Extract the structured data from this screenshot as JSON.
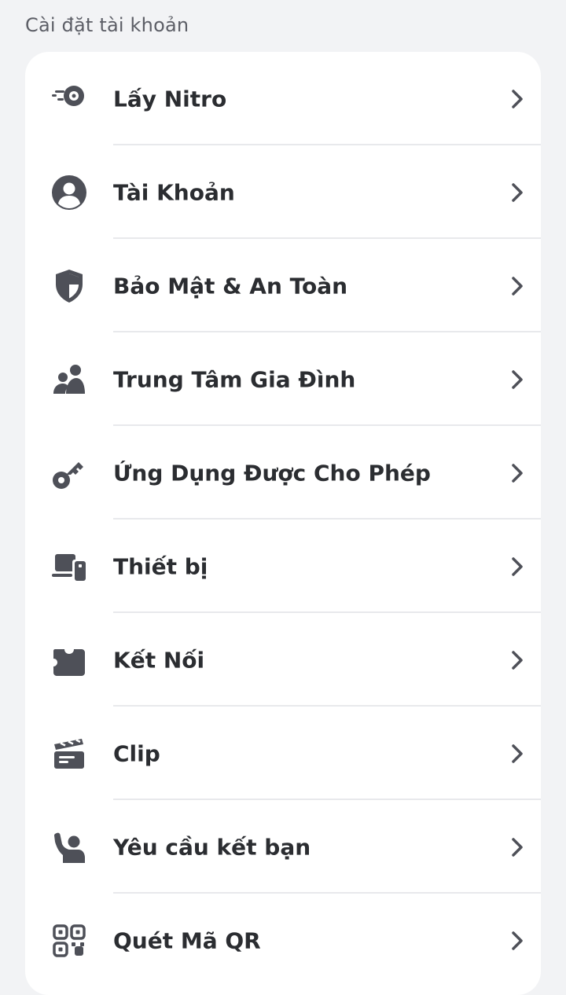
{
  "section_title": "Cài đặt tài khoản",
  "items": [
    {
      "label": "Lấy Nitro",
      "icon": "nitro-icon"
    },
    {
      "label": "Tài Khoản",
      "icon": "account-icon"
    },
    {
      "label": "Bảo Mật & An Toàn",
      "icon": "shield-icon"
    },
    {
      "label": "Trung Tâm Gia Đình",
      "icon": "family-icon"
    },
    {
      "label": "Ứng Dụng Được Cho Phép",
      "icon": "key-icon"
    },
    {
      "label": "Thiết bị",
      "icon": "devices-icon"
    },
    {
      "label": "Kết Nối",
      "icon": "puzzle-icon"
    },
    {
      "label": "Clip",
      "icon": "clapperboard-icon"
    },
    {
      "label": "Yêu cầu kết bạn",
      "icon": "friend-request-icon"
    },
    {
      "label": "Quét Mã QR",
      "icon": "qr-code-icon"
    }
  ],
  "colors": {
    "background": "#f2f3f5",
    "card": "#ffffff",
    "text": "#2b2d31",
    "icon": "#4e5058",
    "divider": "#e8e9ec"
  }
}
